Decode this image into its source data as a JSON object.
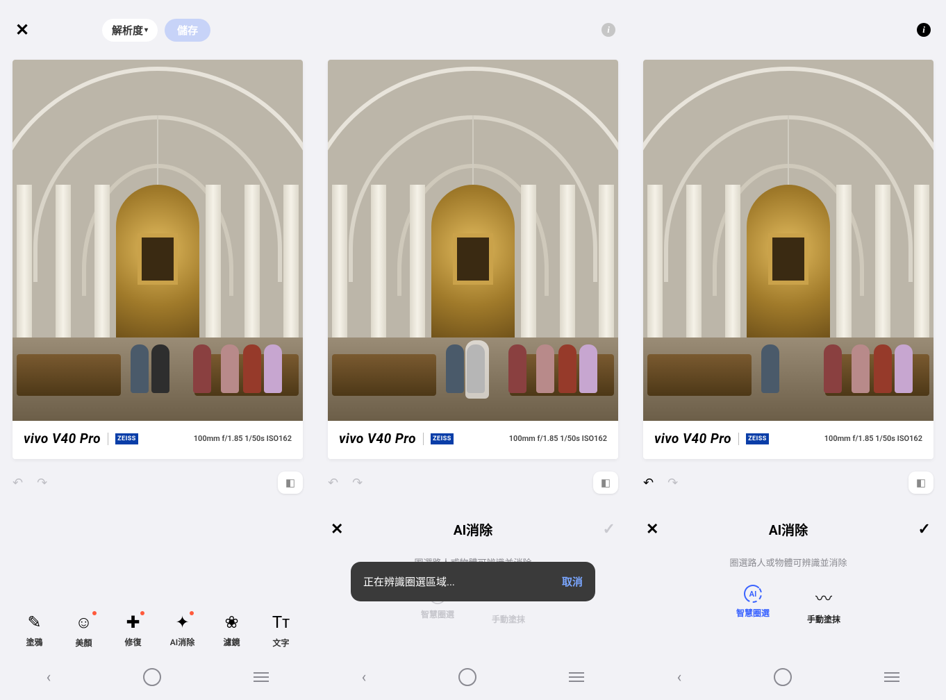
{
  "screen1": {
    "resolution_label": "解析度",
    "save_label": "儲存",
    "watermark": {
      "brand": "vivo V40 Pro",
      "partner": "ZEISS",
      "meta": "100mm  f/1.85  1/50s  ISO162"
    },
    "tools": [
      {
        "label": "塗鴉"
      },
      {
        "label": "美顏"
      },
      {
        "label": "修復"
      },
      {
        "label": "AI消除"
      },
      {
        "label": "濾鏡"
      },
      {
        "label": "文字"
      }
    ]
  },
  "screen2": {
    "watermark": {
      "brand": "vivo V40 Pro",
      "partner": "ZEISS",
      "meta": "100mm  f/1.85  1/50s  ISO162"
    },
    "ai_title": "AI消除",
    "hint": "圈選路人或物體可辨識並消除",
    "toast_msg": "正在辨識圈選區域...",
    "toast_cancel": "取消",
    "modes": [
      {
        "label": "智慧圈選"
      },
      {
        "label": "手動塗抹"
      }
    ]
  },
  "screen3": {
    "watermark": {
      "brand": "vivo V40 Pro",
      "partner": "ZEISS",
      "meta": "100mm  f/1.85  1/50s  ISO162"
    },
    "ai_title": "AI消除",
    "hint": "圈選路人或物體可辨識並消除",
    "modes": [
      {
        "label": "智慧圈選"
      },
      {
        "label": "手動塗抹"
      }
    ]
  }
}
